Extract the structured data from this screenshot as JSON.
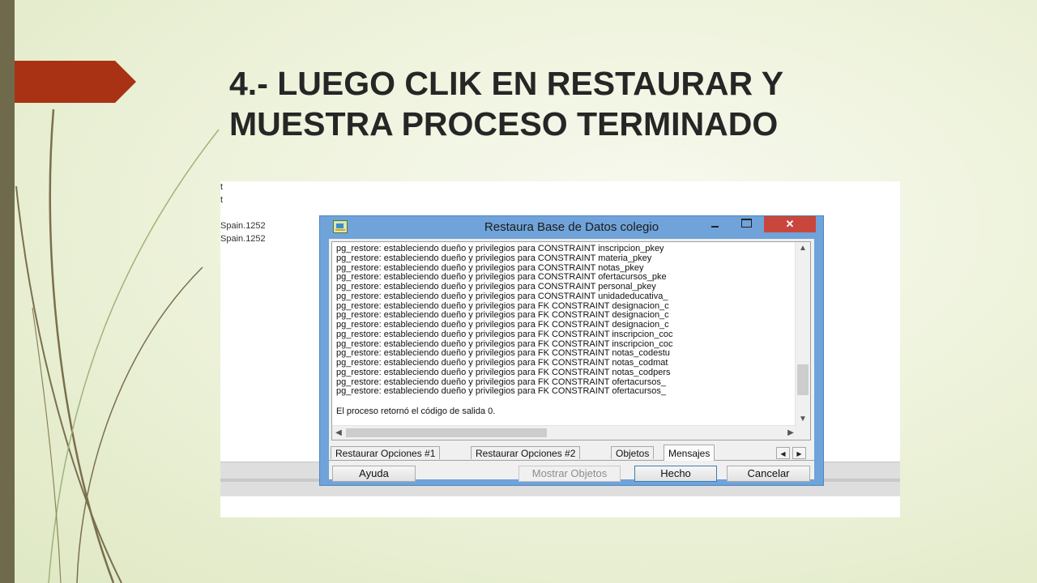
{
  "slide": {
    "title_line1": "4.- LUEGO CLIK EN RESTAURAR Y",
    "title_line2": "MUESTRA PROCESO TERMINADO"
  },
  "background_window": {
    "lines": [
      "t",
      "t",
      "Spain.1252",
      "Spain.1252"
    ]
  },
  "dialog": {
    "title": "Restaura Base de Datos colegio",
    "close_label": "✕",
    "log": [
      "pg_restore: estableciendo dueño y privilegios para CONSTRAINT inscripcion_pkey",
      "pg_restore: estableciendo dueño y privilegios para CONSTRAINT materia_pkey",
      "pg_restore: estableciendo dueño y privilegios para CONSTRAINT notas_pkey",
      "pg_restore: estableciendo dueño y privilegios para CONSTRAINT ofertacursos_pke",
      "pg_restore: estableciendo dueño y privilegios para CONSTRAINT personal_pkey",
      "pg_restore: estableciendo dueño y privilegios para CONSTRAINT unidadeducativa_",
      "pg_restore: estableciendo dueño y privilegios para FK CONSTRAINT designacion_c",
      "pg_restore: estableciendo dueño y privilegios para FK CONSTRAINT designacion_c",
      "pg_restore: estableciendo dueño y privilegios para FK CONSTRAINT designacion_c",
      "pg_restore: estableciendo dueño y privilegios para FK CONSTRAINT inscripcion_coc",
      "pg_restore: estableciendo dueño y privilegios para FK CONSTRAINT inscripcion_coc",
      "pg_restore: estableciendo dueño y privilegios para FK CONSTRAINT notas_codestu",
      "pg_restore: estableciendo dueño y privilegios para FK CONSTRAINT notas_codmat",
      "pg_restore: estableciendo dueño y privilegios para FK CONSTRAINT notas_codpers",
      "pg_restore: estableciendo dueño y privilegios para FK CONSTRAINT ofertacursos_",
      "pg_restore: estableciendo dueño y privilegios para FK CONSTRAINT ofertacursos_"
    ],
    "exit_message": "El proceso retornó el código de salida  0.",
    "tabs": [
      {
        "label": "Restaurar Opciones #1",
        "active": false
      },
      {
        "label": "Restaurar Opciones #2",
        "active": false
      },
      {
        "label": "Objetos",
        "active": false
      },
      {
        "label": "Mensajes",
        "active": true
      }
    ],
    "buttons": {
      "help": "Ayuda",
      "show_objects": "Mostrar Objetos",
      "done": "Hecho",
      "cancel": "Cancelar"
    },
    "scroll": {
      "vertical_position": 0.86,
      "horizontal_position": 0.0
    }
  },
  "colors": {
    "accent": "#a83213",
    "left_bar": "#6f6a4c",
    "title_text": "#262626",
    "dialog_frame": "#6fa3d9",
    "close_button": "#c9463d"
  }
}
